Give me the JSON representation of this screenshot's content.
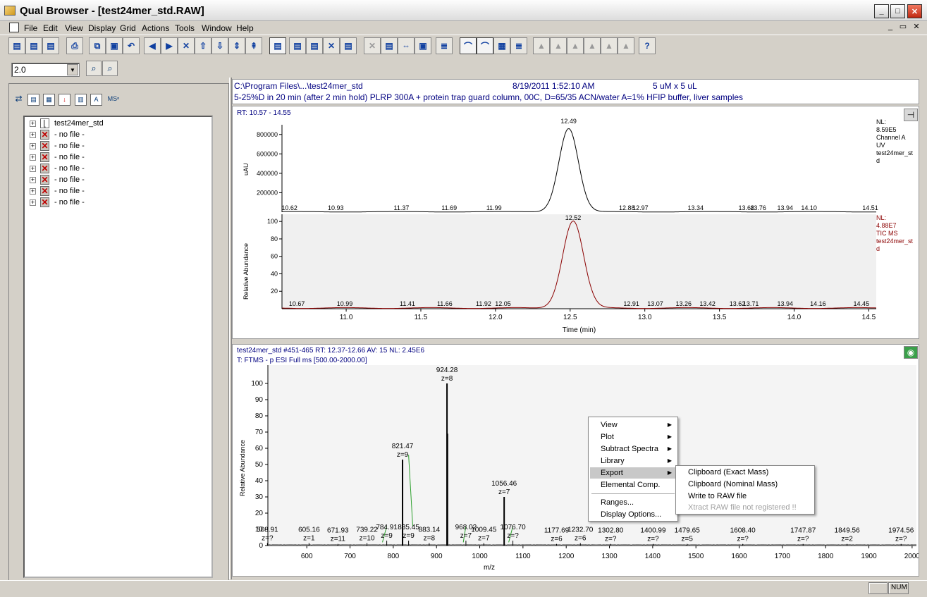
{
  "window": {
    "title": "Qual Browser - [test24mer_std.RAW]",
    "min": "_",
    "max": "□",
    "close": "✕"
  },
  "menu": {
    "items": [
      "File",
      "Edit",
      "View",
      "Display",
      "Grid",
      "Actions",
      "Tools",
      "Window",
      "Help"
    ],
    "mdi": [
      "_",
      "▭",
      "✕"
    ]
  },
  "toolbar": {
    "buttons": [
      "open-icon",
      "open-multi-icon",
      "batch-icon",
      "print-icon",
      "copy-icon",
      "paste-icon",
      "undo-icon",
      "back-icon",
      "forward-icon",
      "zoom-reset-icon",
      "scroll-up-icon",
      "scroll-down-icon",
      "scroll-updown-icon",
      "normalize-icon",
      "cell-icon",
      "spectrum-icon",
      "chromatogram-icon",
      "delete-cell-icon",
      "auto-icon",
      "zoom-x-icon",
      "zoom-y-icon",
      "zoom-xy-icon",
      "zoom-fit-icon",
      "mass-list-icon",
      "chrom-view-icon",
      "spectrum-view-icon",
      "map-view-icon",
      "list-view-icon",
      "peak-1-icon",
      "peak-2-icon",
      "peak-3-icon",
      "peak-4-icon",
      "peak-5-icon",
      "peak-6-icon",
      "help-icon"
    ]
  },
  "zoom": {
    "value": "2.0"
  },
  "leftpanel": {
    "tabs": [
      "ms-info",
      "report",
      "scan-filter",
      "qual",
      "spec",
      "text",
      "msn"
    ],
    "tab_msn": "MSⁿ"
  },
  "tree": {
    "items": [
      {
        "label": "test24mer_std",
        "type": "file"
      },
      {
        "label": "- no file -",
        "type": "nofile"
      },
      {
        "label": "- no file -",
        "type": "nofile"
      },
      {
        "label": "- no file -",
        "type": "nofile"
      },
      {
        "label": "- no file -",
        "type": "nofile"
      },
      {
        "label": "- no file -",
        "type": "nofile"
      },
      {
        "label": "- no file -",
        "type": "nofile"
      },
      {
        "label": "- no file -",
        "type": "nofile"
      }
    ]
  },
  "header": {
    "path": "C:\\Program Files\\...\\test24mer_std",
    "date": "8/19/2011 1:52:10 AM",
    "injection": "5 uM x 5 uL",
    "method": "5-25%D in 20 min (after 2 min hold) PLRP 300A + protein trap guard column, 00C, D=65/35 ACN/water  A=1% HFIP buffer, liver samples"
  },
  "chrom": {
    "rt_label": "RT: 10.57 - 14.55",
    "uv": {
      "nl": "NL:",
      "nl_val": "8.59E5",
      "ch": "Channel A",
      "det": "UV",
      "file": "test24mer_st",
      "file2": "d"
    },
    "ms": {
      "nl": "NL:",
      "nl_val": "4.88E7",
      "ch": "TIC  MS",
      "file": "test24mer_st",
      "file2": "d"
    },
    "xlabel": "Time (min)"
  },
  "spec": {
    "title": "test24mer_std #451-465   RT: 12.37-12.66   AV: 15   NL: 2.45E6",
    "filter": "T: FTMS - p ESI Full ms [500.00-2000.00]",
    "xlabel": "m/z",
    "ylabel": "Relative Abundance"
  },
  "context_menu": {
    "items": [
      {
        "label": "View",
        "sub": true
      },
      {
        "label": "Plot",
        "sub": true
      },
      {
        "label": "Subtract Spectra",
        "sub": true
      },
      {
        "label": "Library",
        "sub": true
      },
      {
        "label": "Export",
        "sub": true,
        "highlighted": true
      },
      {
        "label": "Elemental Comp.",
        "sub": false
      },
      {
        "label": "Ranges...",
        "sub": false
      },
      {
        "label": "Display Options...",
        "sub": false
      }
    ]
  },
  "submenu": {
    "items": [
      {
        "label": "Clipboard (Exact Mass)",
        "disabled": false
      },
      {
        "label": "Clipboard (Nominal Mass)",
        "disabled": false
      },
      {
        "label": "Write to RAW file",
        "disabled": false
      },
      {
        "label": "Xtract RAW file not registered !!",
        "disabled": true
      }
    ]
  },
  "status": {
    "num": "NUM"
  },
  "chart_data": [
    {
      "type": "line",
      "ylabel": "uAU",
      "xlim": [
        10.57,
        14.55
      ],
      "yticks": [
        200000,
        400000,
        600000,
        800000
      ],
      "peak_labels": [
        {
          "x": 10.62,
          "label": "10.62"
        },
        {
          "x": 10.93,
          "label": "10.93"
        },
        {
          "x": 11.37,
          "label": "11.37"
        },
        {
          "x": 11.69,
          "label": "11.69"
        },
        {
          "x": 11.99,
          "label": "11.99"
        },
        {
          "x": 12.49,
          "label": "12.49"
        },
        {
          "x": 12.88,
          "label": "12.88"
        },
        {
          "x": 12.97,
          "label": "12.97"
        },
        {
          "x": 13.34,
          "label": "13.34"
        },
        {
          "x": 13.68,
          "label": "13.68"
        },
        {
          "x": 13.76,
          "label": "13.76"
        },
        {
          "x": 13.94,
          "label": "13.94"
        },
        {
          "x": 14.1,
          "label": "14.10"
        },
        {
          "x": 14.51,
          "label": "14.51"
        }
      ],
      "series": [
        {
          "peak_rt": 12.49,
          "peak_height": 859000,
          "width": 0.065
        }
      ]
    },
    {
      "type": "line",
      "ylabel": "Relative Abundance",
      "xlabel": "Time (min)",
      "xlim": [
        10.57,
        14.55
      ],
      "ylim": [
        0,
        100
      ],
      "xticks": [
        11.0,
        11.5,
        12.0,
        12.5,
        13.0,
        13.5,
        14.0,
        14.5
      ],
      "yticks": [
        20,
        40,
        60,
        80,
        100
      ],
      "peak_labels": [
        {
          "x": 10.67,
          "label": "10.67"
        },
        {
          "x": 10.99,
          "label": "10.99"
        },
        {
          "x": 11.41,
          "label": "11.41"
        },
        {
          "x": 11.66,
          "label": "11.66"
        },
        {
          "x": 11.92,
          "label": "11.92"
        },
        {
          "x": 12.05,
          "label": "12.05"
        },
        {
          "x": 12.52,
          "label": "12.52"
        },
        {
          "x": 12.91,
          "label": "12.91"
        },
        {
          "x": 13.07,
          "label": "13.07"
        },
        {
          "x": 13.26,
          "label": "13.26"
        },
        {
          "x": 13.42,
          "label": "13.42"
        },
        {
          "x": 13.62,
          "label": "13.62"
        },
        {
          "x": 13.71,
          "label": "13.71"
        },
        {
          "x": 13.94,
          "label": "13.94"
        },
        {
          "x": 14.16,
          "label": "14.16"
        },
        {
          "x": 14.45,
          "label": "14.45"
        }
      ],
      "series": [
        {
          "peak_rt": 12.52,
          "peak_height": 100,
          "width": 0.07
        }
      ]
    },
    {
      "type": "bar",
      "xlabel": "m/z",
      "ylabel": "Relative Abundance",
      "xlim": [
        510,
        2010
      ],
      "ylim": [
        0,
        105
      ],
      "xticks": [
        600,
        700,
        800,
        900,
        1000,
        1100,
        1200,
        1300,
        1400,
        1500,
        1600,
        1700,
        1800,
        1900,
        2000
      ],
      "yticks": [
        0,
        10,
        20,
        30,
        40,
        50,
        60,
        70,
        80,
        90,
        100
      ],
      "peaks": [
        {
          "mz": 508.91,
          "rel": 1.5,
          "label": "508.91",
          "z": "z=?"
        },
        {
          "mz": 605.16,
          "rel": 1.5,
          "label": "605.16",
          "z": "z=1"
        },
        {
          "mz": 671.93,
          "rel": 1.0,
          "label": "671.93",
          "z": "z=11"
        },
        {
          "mz": 739.22,
          "rel": 1.5,
          "label": "739.22",
          "z": "z=10"
        },
        {
          "mz": 784.91,
          "rel": 3.0,
          "label": "784.91",
          "z": "z=9"
        },
        {
          "mz": 821.47,
          "rel": 53,
          "label": "821.47",
          "z": "z=9"
        },
        {
          "mz": 835.45,
          "rel": 3.0,
          "label": "835.45",
          "z": "z=9"
        },
        {
          "mz": 883.14,
          "rel": 1.5,
          "label": "883.14",
          "z": "z=8"
        },
        {
          "mz": 924.28,
          "rel": 100,
          "label": "924.28",
          "z": "z=8"
        },
        {
          "mz": 925.4,
          "rel": 69,
          "label": "",
          "z": ""
        },
        {
          "mz": 968.02,
          "rel": 3.0,
          "label": "968.02",
          "z": "z=7"
        },
        {
          "mz": 1009.45,
          "rel": 1.5,
          "label": "1009.45",
          "z": "z=7"
        },
        {
          "mz": 1056.46,
          "rel": 30,
          "label": "1056.46",
          "z": "z=7"
        },
        {
          "mz": 1076.7,
          "rel": 3.0,
          "label": "1076.70",
          "z": "z=?"
        },
        {
          "mz": 1177.69,
          "rel": 1.0,
          "label": "1177.69",
          "z": "z=6"
        },
        {
          "mz": 1232.7,
          "rel": 1.5,
          "label": "1232.70",
          "z": "z=6"
        },
        {
          "mz": 1302.8,
          "rel": 1.0,
          "label": "1302.80",
          "z": "z=?"
        },
        {
          "mz": 1400.99,
          "rel": 1.0,
          "label": "1400.99",
          "z": "z=?"
        },
        {
          "mz": 1479.65,
          "rel": 1.0,
          "label": "1479.65",
          "z": "z=5"
        },
        {
          "mz": 1608.4,
          "rel": 1.0,
          "label": "1608.40",
          "z": "z=?"
        },
        {
          "mz": 1747.87,
          "rel": 1.0,
          "label": "1747.87",
          "z": "z=?"
        },
        {
          "mz": 1849.56,
          "rel": 1.0,
          "label": "1849.56",
          "z": "z=2"
        },
        {
          "mz": 1974.56,
          "rel": 1.0,
          "label": "1974.56",
          "z": "z=?"
        }
      ]
    }
  ]
}
